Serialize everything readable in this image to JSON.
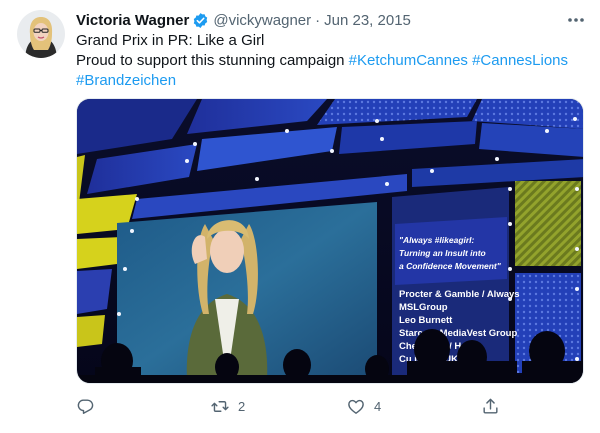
{
  "tweet": {
    "author": {
      "name": "Victoria Wagner",
      "handle": "@vickywagner",
      "separator": "·",
      "date": "Jun 23, 2015",
      "verified": true
    },
    "text": {
      "line1": "Grand Prix in PR: Like a Girl",
      "line2_prefix": "Proud to support this stunning campaign ",
      "hashtags": [
        "#KetchumCannes",
        "#CannesLions",
        "#Brandzeichen"
      ]
    },
    "media": {
      "screen_text": {
        "quote": [
          "\"Always #likeagirl:",
          "Turning an Insult into",
          "a Confidence Movement\""
        ],
        "credits": [
          "Procter & Gamble / Always",
          "MSLGroup",
          "Leo Burnett",
          "Starcom MediaVest Group",
          "Che    a F     es / Holler",
          "Cu     ia  /  A / UK"
        ]
      }
    },
    "actions": {
      "reply_icon": "reply-icon",
      "retweet_icon": "retweet-icon",
      "retweet_count": "2",
      "like_icon": "heart-icon",
      "like_count": "4",
      "share_icon": "share-icon"
    }
  },
  "colors": {
    "link": "#1d9bf0",
    "secondary_text": "#536471",
    "primary_text": "#0f1419",
    "verified_badge": "#1d9bf0"
  }
}
